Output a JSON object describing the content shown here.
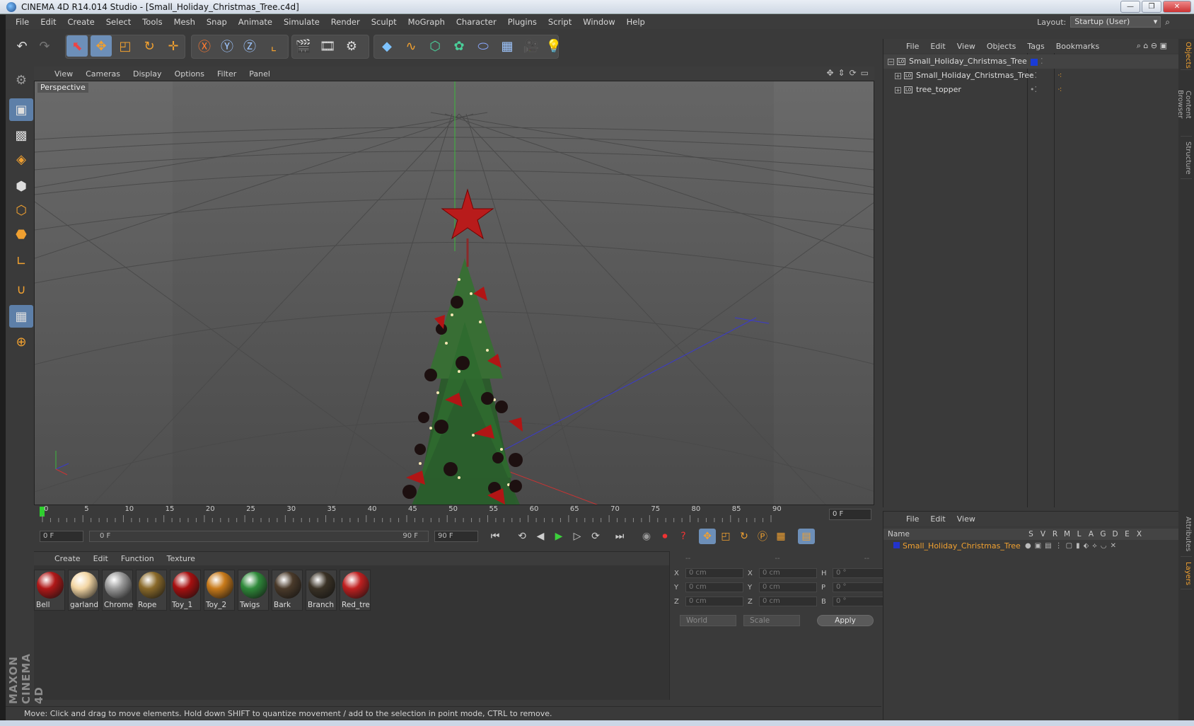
{
  "window": {
    "title": "CINEMA 4D R14.014 Studio - [Small_Holiday_Christmas_Tree.c4d]"
  },
  "menubar": {
    "items": [
      "File",
      "Edit",
      "Create",
      "Select",
      "Tools",
      "Mesh",
      "Snap",
      "Animate",
      "Simulate",
      "Render",
      "Sculpt",
      "MoGraph",
      "Character",
      "Plugins",
      "Script",
      "Window",
      "Help"
    ],
    "layout_label": "Layout:",
    "layout_value": "Startup (User)"
  },
  "viewport": {
    "menu": [
      "View",
      "Cameras",
      "Display",
      "Options",
      "Filter",
      "Panel"
    ],
    "label": "Perspective"
  },
  "timeline": {
    "ticks": [
      "0",
      "5",
      "10",
      "15",
      "20",
      "25",
      "30",
      "35",
      "40",
      "45",
      "50",
      "55",
      "60",
      "65",
      "70",
      "75",
      "80",
      "85",
      "90"
    ],
    "current_frame": "0 F",
    "start_field": "0 F",
    "range_start": "0 F",
    "range_end": "90 F",
    "end_field": "90 F"
  },
  "materials": {
    "menu": [
      "Create",
      "Edit",
      "Function",
      "Texture"
    ],
    "items": [
      {
        "name": "Bell",
        "color": "#b01818"
      },
      {
        "name": "garland",
        "color": "#f3d6a4"
      },
      {
        "name": "Chrome",
        "color": "#9a9a9a"
      },
      {
        "name": "Rope",
        "color": "#8a6a2a"
      },
      {
        "name": "Toy_1",
        "color": "#a81010"
      },
      {
        "name": "Toy_2",
        "color": "#c87a1a"
      },
      {
        "name": "Twigs",
        "color": "#2f8a3a"
      },
      {
        "name": "Bark",
        "color": "#4a3a2a"
      },
      {
        "name": "Branch",
        "color": "#3a3226"
      },
      {
        "name": "Red_tre",
        "color": "#c02020"
      }
    ]
  },
  "coordinates": {
    "headers": [
      "--",
      "--",
      "--"
    ],
    "rows": [
      {
        "l1": "X",
        "v1": "0 cm",
        "l2": "X",
        "v2": "0 cm",
        "l3": "H",
        "v3": "0 °"
      },
      {
        "l1": "Y",
        "v1": "0 cm",
        "l2": "Y",
        "v2": "0 cm",
        "l3": "P",
        "v3": "0 °"
      },
      {
        "l1": "Z",
        "v1": "0 cm",
        "l2": "Z",
        "v2": "0 cm",
        "l3": "B",
        "v3": "0 °"
      }
    ],
    "world": "World",
    "scale": "Scale",
    "apply": "Apply"
  },
  "objects_panel": {
    "menu": [
      "File",
      "Edit",
      "View",
      "Objects",
      "Tags",
      "Bookmarks"
    ],
    "items": [
      "Small_Holiday_Christmas_Tree",
      "Small_Holiday_Christmas_Tree",
      "tree_topper"
    ]
  },
  "layers_panel": {
    "menu": [
      "File",
      "Edit",
      "View"
    ],
    "columns": [
      "Name",
      "S",
      "V",
      "R",
      "M",
      "L",
      "A",
      "G",
      "D",
      "E",
      "X"
    ],
    "row_name": "Small_Holiday_Christmas_Tree"
  },
  "side_tabs": [
    "Objects",
    "Content Browser",
    "Structure",
    "Attributes",
    "Layers"
  ],
  "status": "Move: Click and drag to move elements. Hold down SHIFT to quantize movement / add to the selection in point mode, CTRL to remove.",
  "logo": {
    "text": "MAXON CINEMA 4D"
  },
  "colors": {
    "accent": "#f0a030",
    "selected_blue": "#6d8fb8",
    "layer_color": "#2233cc"
  }
}
